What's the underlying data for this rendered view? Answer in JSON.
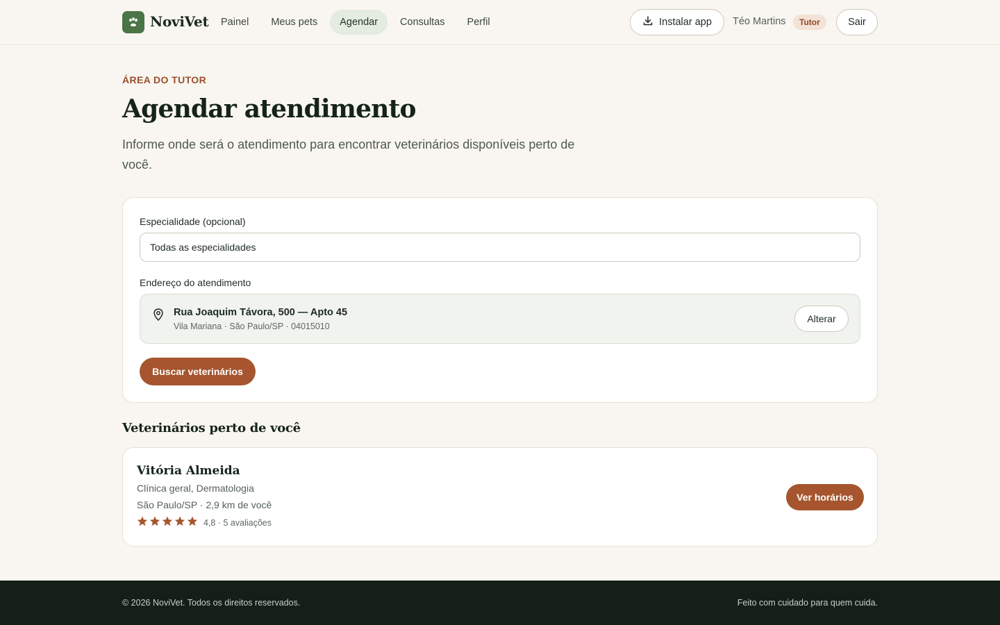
{
  "header": {
    "logo_text": "NoviVet",
    "nav": [
      {
        "label": "Painel",
        "active": false
      },
      {
        "label": "Meus pets",
        "active": false
      },
      {
        "label": "Agendar",
        "active": true
      },
      {
        "label": "Consultas",
        "active": false
      },
      {
        "label": "Perfil",
        "active": false
      }
    ],
    "install_label": "Instalar app",
    "user_name": "Téo Martins",
    "role_badge": "Tutor",
    "logout_label": "Sair"
  },
  "hero": {
    "eyebrow": "ÁREA DO TUTOR",
    "title": "Agendar atendimento",
    "subtitle": "Informe onde será o atendimento para encontrar veterinários disponíveis perto de você."
  },
  "form": {
    "specialty_label": "Especialidade (opcional)",
    "specialty_value": "Todas as especialidades",
    "address_label": "Endereço do atendimento",
    "address_line1": "Rua Joaquim Távora, 500 — Apto 45",
    "address_line2": "Vila Mariana · São Paulo/SP · 04015010",
    "change_label": "Alterar",
    "search_label": "Buscar veterinários"
  },
  "results": {
    "section_title": "Veterinários perto de você",
    "vets": [
      {
        "name": "Vitória Almeida",
        "specialties": "Clínica geral, Dermatologia",
        "location": "São Paulo/SP · 2,9 km de você",
        "rating_text": "4,8 · 5 avaliações",
        "stars": 5,
        "button_label": "Ver horários"
      }
    ]
  },
  "footer": {
    "copyright": "© 2026 NoviVet. Todos os direitos reservados.",
    "tagline": "Feito com cuidado para quem cuida."
  },
  "colors": {
    "brand_green": "#4b7447",
    "accent": "#a6552e",
    "background": "#f9f6f1",
    "footer_bg": "#131f17"
  }
}
